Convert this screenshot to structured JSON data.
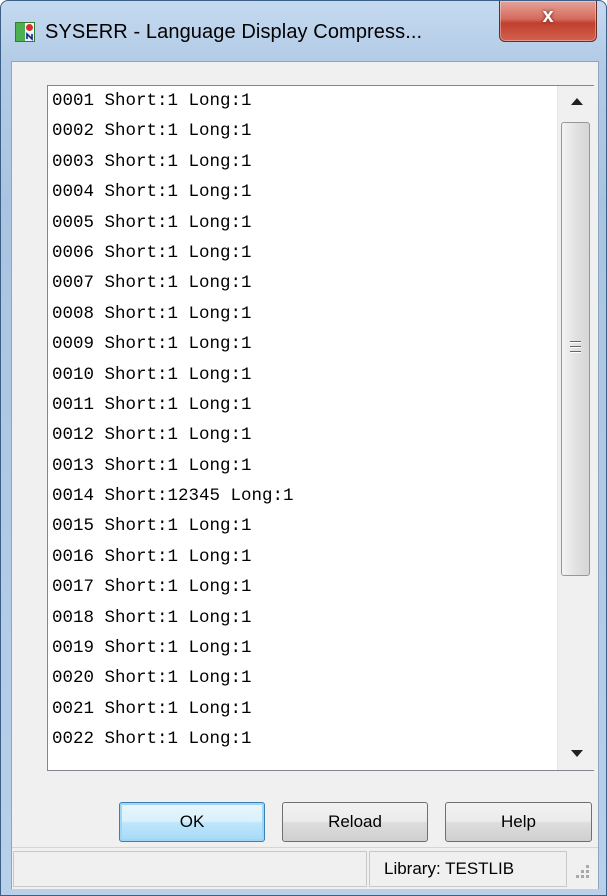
{
  "window": {
    "title": "SYSERR - Language Display Compress...",
    "close_glyph": "x"
  },
  "list": {
    "items": [
      "0001 Short:1 Long:1",
      "0002 Short:1 Long:1",
      "0003 Short:1 Long:1",
      "0004 Short:1 Long:1",
      "0005 Short:1 Long:1",
      "0006 Short:1 Long:1",
      "0007 Short:1 Long:1",
      "0008 Short:1 Long:1",
      "0009 Short:1 Long:1",
      "0010 Short:1 Long:1",
      "0011 Short:1 Long:1",
      "0012 Short:1 Long:1",
      "0013 Short:1 Long:1",
      "0014 Short:12345 Long:1",
      "0015 Short:1 Long:1",
      "0016 Short:1 Long:1",
      "0017 Short:1 Long:1",
      "0018 Short:1 Long:1",
      "0019 Short:1 Long:1",
      "0020 Short:1 Long:1",
      "0021 Short:1 Long:1",
      "0022 Short:1 Long:1"
    ]
  },
  "buttons": {
    "ok_label": "OK",
    "reload_label": "Reload",
    "help_label": "Help"
  },
  "statusbar": {
    "left_text": "",
    "library_text": "Library: TESTLIB"
  },
  "icons": {
    "app": "app-icon",
    "close": "close-icon",
    "scroll_up": "chevron-up-icon",
    "scroll_down": "chevron-down-icon",
    "grip": "resize-grip-icon"
  },
  "colors": {
    "frame": "#b3cbe6",
    "close_button": "#c0402d",
    "default_button": "#bee6fd"
  }
}
